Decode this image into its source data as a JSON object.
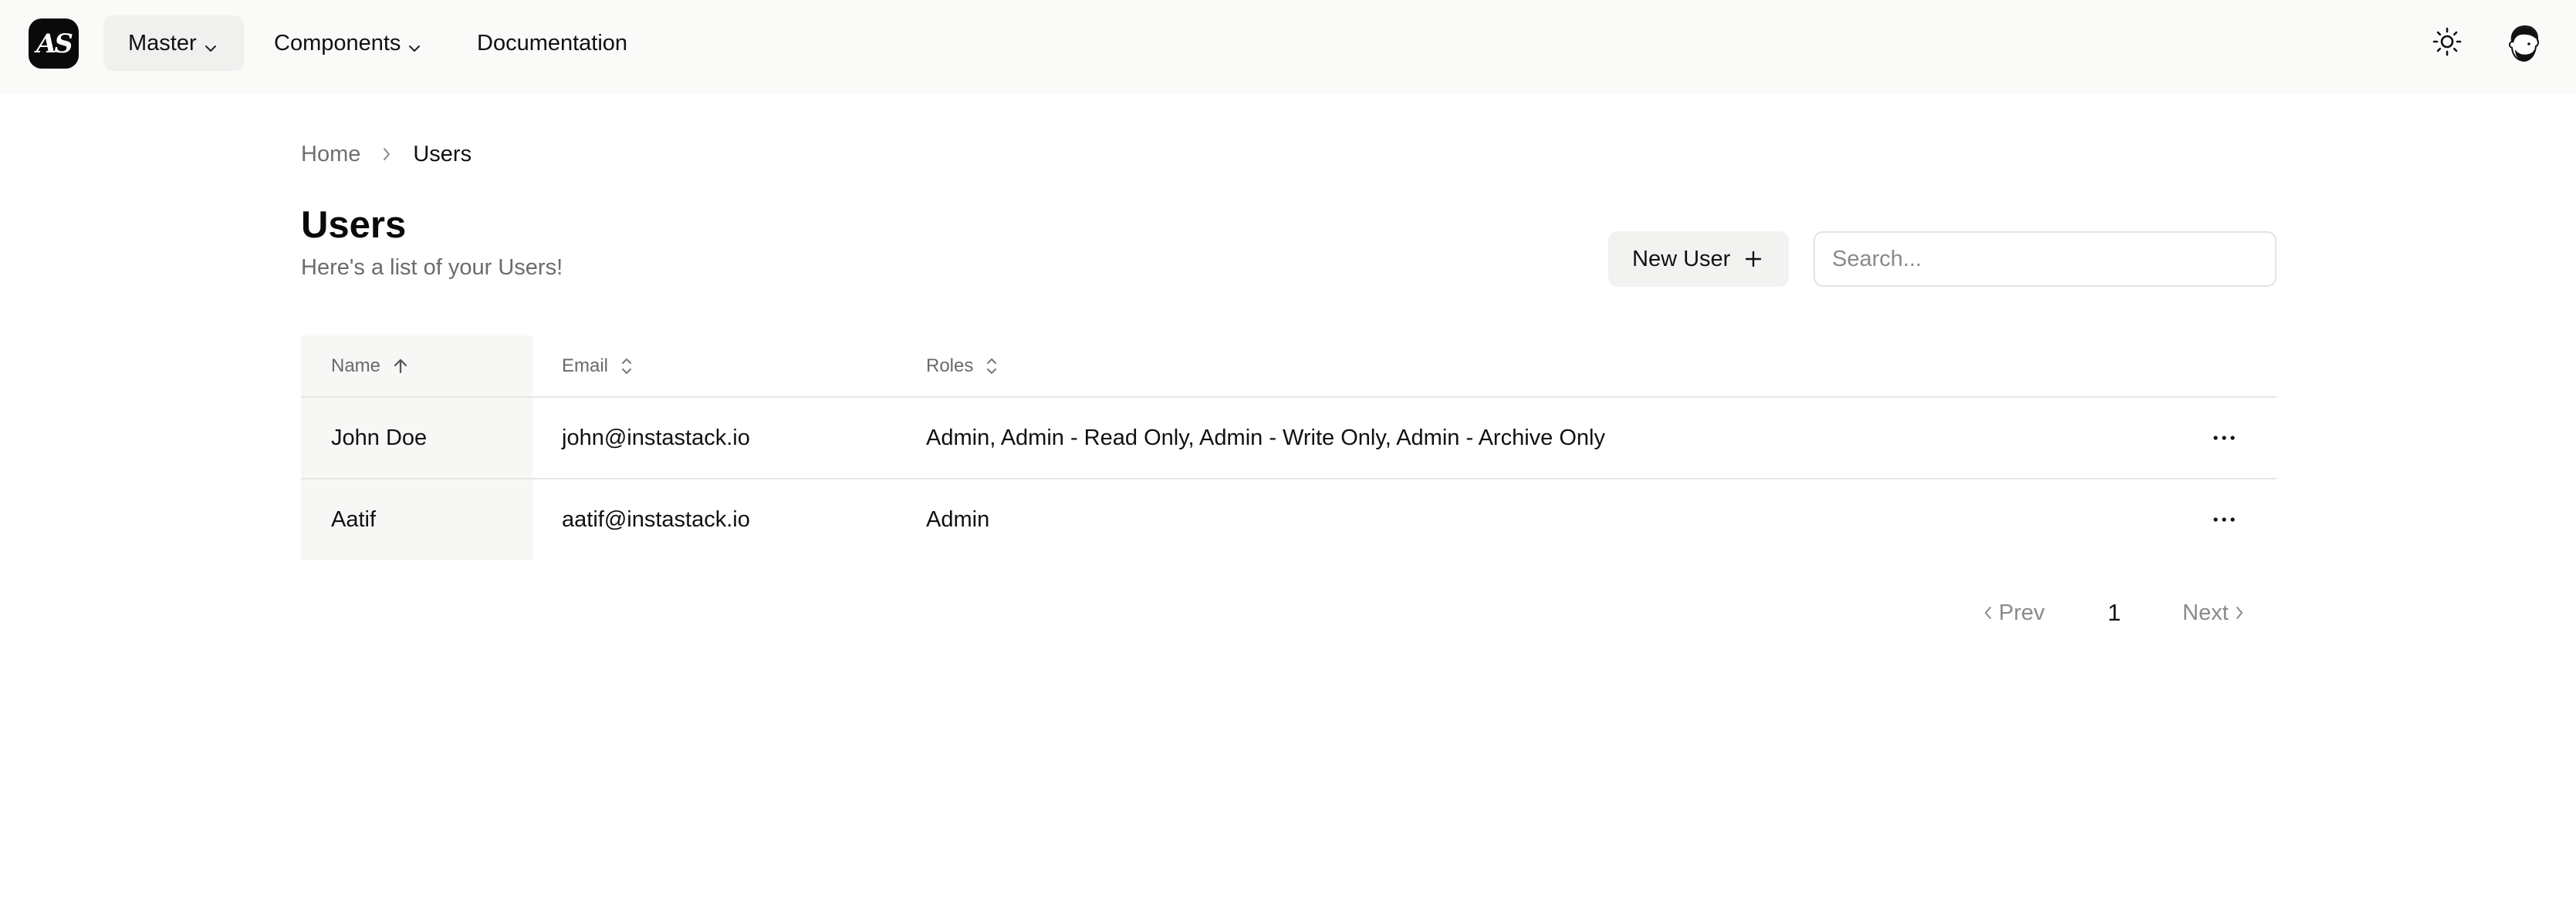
{
  "nav": {
    "logo_text": "AS",
    "master_label": "Master",
    "components_label": "Components",
    "documentation_label": "Documentation",
    "theme_icon": "sun-icon",
    "avatar_icon": "avatar-icon"
  },
  "breadcrumb": {
    "home": "Home",
    "current": "Users"
  },
  "header": {
    "title": "Users",
    "subtitle": "Here's a list of your Users!",
    "new_user_label": "New User",
    "search_placeholder": "Search...",
    "search_value": ""
  },
  "table": {
    "columns": [
      {
        "label": "Name",
        "sort": "ascending"
      },
      {
        "label": "Email",
        "sort": "none"
      },
      {
        "label": "Roles",
        "sort": "none"
      }
    ],
    "rows": [
      {
        "name": "John Doe",
        "email": "john@instastack.io",
        "roles": "Admin, Admin - Read Only, Admin - Write Only, Admin - Archive Only"
      },
      {
        "name": "Aatif",
        "email": "aatif@instastack.io",
        "roles": "Admin"
      }
    ]
  },
  "pagination": {
    "prev_label": "Prev",
    "current_page": "1",
    "next_label": "Next"
  },
  "colors": {
    "topbar_bg": "#fafaf9",
    "button_bg": "#f2f2f1",
    "name_column_bg": "#f7f7f6",
    "muted_text": "#6b6b6b",
    "border": "#e6e6e4"
  }
}
